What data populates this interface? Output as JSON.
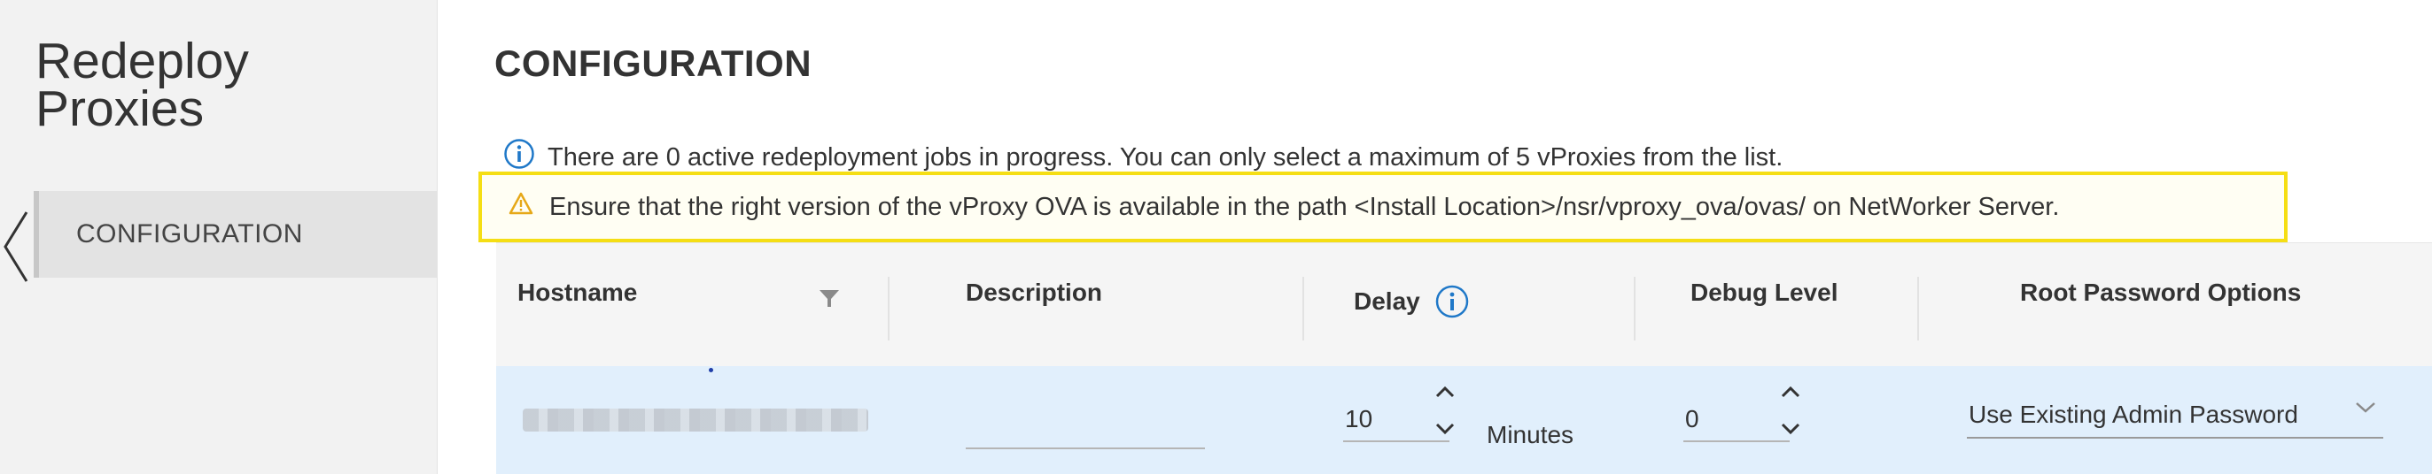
{
  "sidebar": {
    "title": "Redeploy\nProxies",
    "nav_items": [
      {
        "label": "CONFIGURATION",
        "active": true
      }
    ]
  },
  "main": {
    "heading": "CONFIGURATION",
    "info_message": "There are 0 active redeployment jobs in progress. You can only select a maximum of 5 vProxies from the list.",
    "warning_message": "Ensure that the right version of the vProxy OVA is available in the path <Install Location>/nsr/vproxy_ova/ovas/ on NetWorker Server."
  },
  "table": {
    "columns": {
      "hostname": "Hostname",
      "description": "Description",
      "delay": "Delay",
      "debug_level": "Debug Level",
      "root_password_options": "Root Password Options"
    },
    "rows": [
      {
        "description": "",
        "delay": "10",
        "delay_unit": "Minutes",
        "debug_level": "0",
        "root_password_option": "Use Existing Admin Password"
      }
    ]
  },
  "colors": {
    "sidebar_bg": "#f2f2f2",
    "nav_active_bg": "#e3e3e3",
    "warning_border": "#f5de14",
    "info_icon": "#1f78c8",
    "warning_icon": "#e6a817",
    "selected_row_bg": "#e1effc"
  },
  "icons": {
    "collapse": "chevron-left-icon",
    "info": "info-circle-icon",
    "warning": "warning-triangle-icon",
    "filter": "filter-icon",
    "stepper": "chevron-up-down-icon",
    "dropdown": "chevron-down-icon"
  }
}
